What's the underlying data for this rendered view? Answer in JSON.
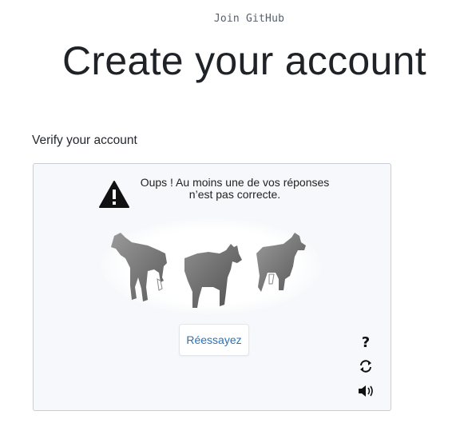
{
  "header": {
    "kicker": "Join GitHub",
    "title": "Create your account"
  },
  "verification": {
    "section_label": "Verify your account",
    "error_message_line1": "Oups ! Au moins une de vos réponses",
    "error_message_line2": "n’est pas correcte.",
    "retry_label": "Réessayez",
    "help_symbol": "?",
    "images": [
      {
        "name": "animal-image-1",
        "icon": "goat-figure"
      },
      {
        "name": "animal-image-2",
        "icon": "goat-figure"
      },
      {
        "name": "animal-image-3",
        "icon": "goat-figure"
      }
    ],
    "controls": [
      "help-icon",
      "reload-icon",
      "audio-icon"
    ]
  },
  "colors": {
    "accent": "#2a73b8",
    "panel_background": "#f6f8fb",
    "panel_border": "#c9ced6",
    "warning": "#111111"
  }
}
